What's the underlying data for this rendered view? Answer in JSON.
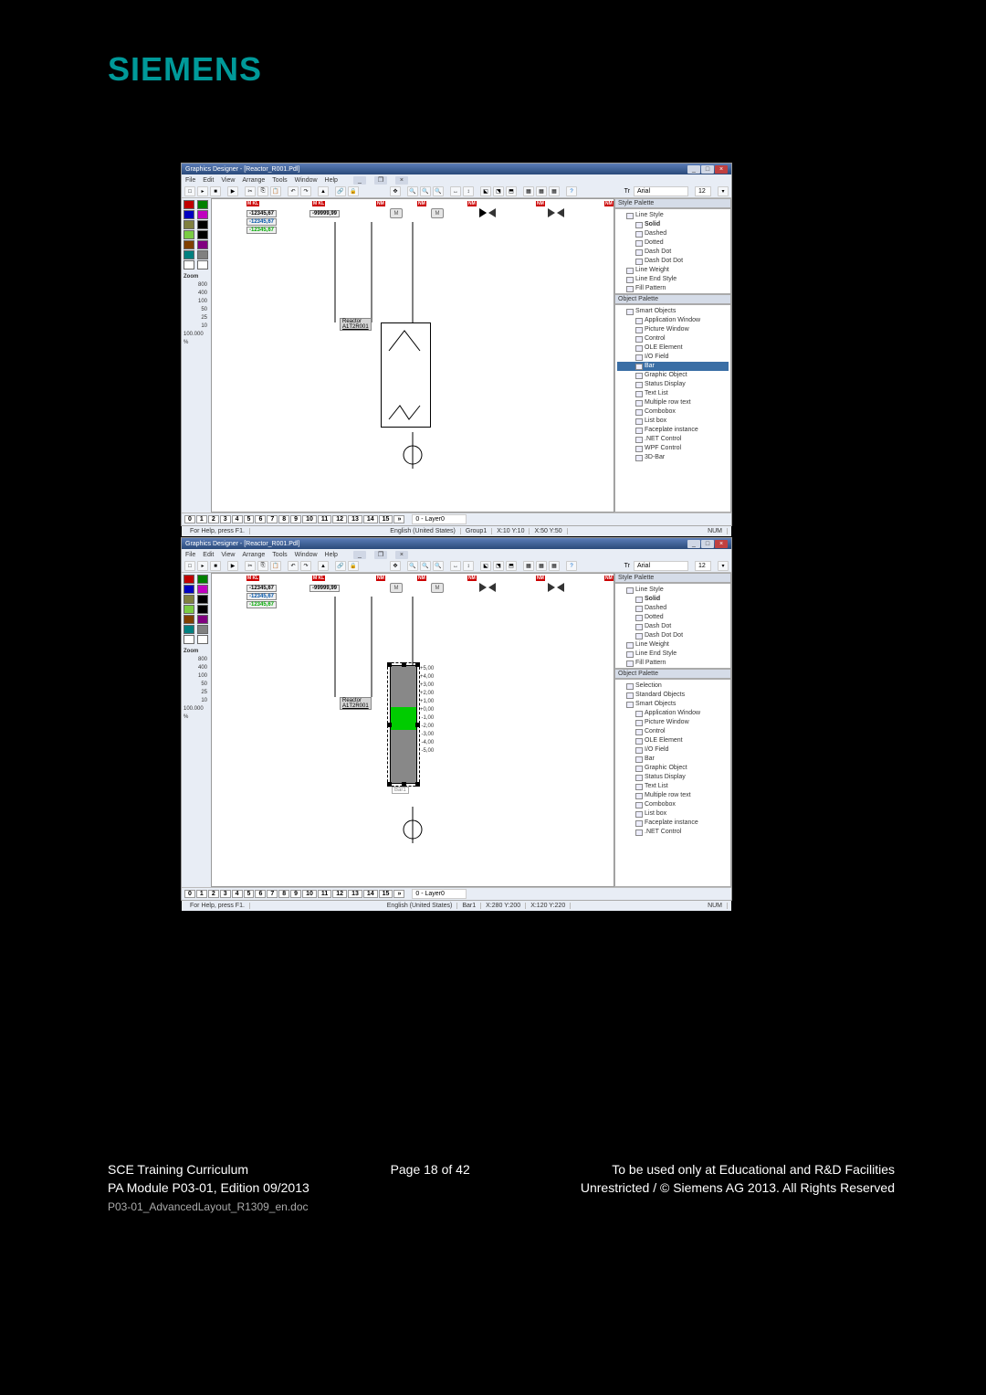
{
  "logo": "SIEMENS",
  "app": {
    "title": "Graphics Designer - [Reactor_R001.Pdl]",
    "menus": [
      "File",
      "Edit",
      "View",
      "Arrange",
      "Tools",
      "Window",
      "Help"
    ],
    "font_name": "Arial",
    "font_size": "12",
    "layer_label": "0 - Layer0",
    "layers": [
      "0",
      "1",
      "2",
      "3",
      "4",
      "5",
      "6",
      "7",
      "8",
      "9",
      "10",
      "11",
      "12",
      "13",
      "14",
      "15"
    ]
  },
  "colors": [
    "#c00000",
    "#008000",
    "#0000c0",
    "#c000c0",
    "#808040",
    "#000000",
    "#7acc44",
    "#000000",
    "#804000",
    "#800080",
    "#008080",
    "#808080",
    "#ffffff",
    "#ffffff"
  ],
  "zoom": {
    "title": "Zoom",
    "levels": [
      "800",
      "400",
      "100",
      "50",
      "25",
      "10"
    ],
    "pct": "100.000"
  },
  "style_palette": {
    "title": "Style Palette",
    "items": [
      {
        "l": 1,
        "label": "Line Style"
      },
      {
        "l": 2,
        "label": "Solid",
        "bold": true
      },
      {
        "l": 2,
        "label": "Dashed"
      },
      {
        "l": 2,
        "label": "Dotted"
      },
      {
        "l": 2,
        "label": "Dash Dot"
      },
      {
        "l": 2,
        "label": "Dash Dot Dot"
      },
      {
        "l": 1,
        "label": "Line Weight"
      },
      {
        "l": 1,
        "label": "Line End Style"
      },
      {
        "l": 1,
        "label": "Fill Pattern"
      }
    ]
  },
  "object_palette": {
    "title": "Object Palette"
  },
  "obj_tree_1": [
    {
      "l": 1,
      "label": "Smart Objects"
    },
    {
      "l": 2,
      "label": "Application Window"
    },
    {
      "l": 2,
      "label": "Picture Window"
    },
    {
      "l": 2,
      "label": "Control"
    },
    {
      "l": 2,
      "label": "OLE Element"
    },
    {
      "l": 2,
      "label": "I/O Field"
    },
    {
      "l": 2,
      "label": "Bar",
      "sel": true
    },
    {
      "l": 2,
      "label": "Graphic Object"
    },
    {
      "l": 2,
      "label": "Status Display"
    },
    {
      "l": 2,
      "label": "Text List"
    },
    {
      "l": 2,
      "label": "Multiple row text"
    },
    {
      "l": 2,
      "label": "Combobox"
    },
    {
      "l": 2,
      "label": "List box"
    },
    {
      "l": 2,
      "label": "Faceplate instance"
    },
    {
      "l": 2,
      "label": ".NET Control"
    },
    {
      "l": 2,
      "label": "WPF Control"
    },
    {
      "l": 2,
      "label": "3D-Bar"
    }
  ],
  "obj_tree_2": [
    {
      "l": 1,
      "label": "Selection"
    },
    {
      "l": 1,
      "label": "Standard Objects"
    },
    {
      "l": 1,
      "label": "Smart Objects"
    },
    {
      "l": 2,
      "label": "Application Window"
    },
    {
      "l": 2,
      "label": "Picture Window"
    },
    {
      "l": 2,
      "label": "Control"
    },
    {
      "l": 2,
      "label": "OLE Element"
    },
    {
      "l": 2,
      "label": "I/O Field"
    },
    {
      "l": 2,
      "label": "Bar"
    },
    {
      "l": 2,
      "label": "Graphic Object"
    },
    {
      "l": 2,
      "label": "Status Display"
    },
    {
      "l": 2,
      "label": "Text List"
    },
    {
      "l": 2,
      "label": "Multiple row text"
    },
    {
      "l": 2,
      "label": "Combobox"
    },
    {
      "l": 2,
      "label": "List box"
    },
    {
      "l": 2,
      "label": "Faceplate instance"
    },
    {
      "l": 2,
      "label": ".NET Control"
    }
  ],
  "canvas1": {
    "vals": [
      "-12345,67",
      "-12345,67",
      "-12345,67"
    ],
    "val2": "-99999,99",
    "reactor_label1": "Reactor",
    "reactor_label2": "A1T2R001",
    "status": {
      "help": "For Help, press F1.",
      "lang": "English (United States)",
      "obj": "Group1",
      "coord1": "X:10 Y:10",
      "coord2": "X:50 Y:50",
      "num": "NUM"
    }
  },
  "canvas2": {
    "vals": [
      "-12345,67",
      "-12345,67",
      "-12345,67"
    ],
    "val2": "-99999,99",
    "reactor_label1": "Reactor",
    "reactor_label2": "A1T2R001",
    "bar_label": "Bar1",
    "scale": [
      "+5,00",
      "+4,00",
      "+3,00",
      "+2,00",
      "+1,00",
      "+0,00",
      "-1,00",
      "-2,00",
      "-3,00",
      "-4,00",
      "-5,00"
    ],
    "status": {
      "help": "For Help, press F1.",
      "lang": "English (United States)",
      "obj": "Bar1",
      "coord1": "X:280 Y:200",
      "coord2": "X:120 Y:220",
      "num": "NUM"
    }
  },
  "m_label": "M",
  "footer": {
    "row1_left": "SCE Training Curriculum",
    "row1_center": "Page 18 of 42",
    "row1_right": "To be used only at Educational and R&D Facilities",
    "row2_left": "PA Module P03-01, Edition 09/2013",
    "row2_right": "Unrestricted / © Siemens AG 2013. All Rights Reserved",
    "file": "P03-01_AdvancedLayout_R1309_en.doc"
  }
}
